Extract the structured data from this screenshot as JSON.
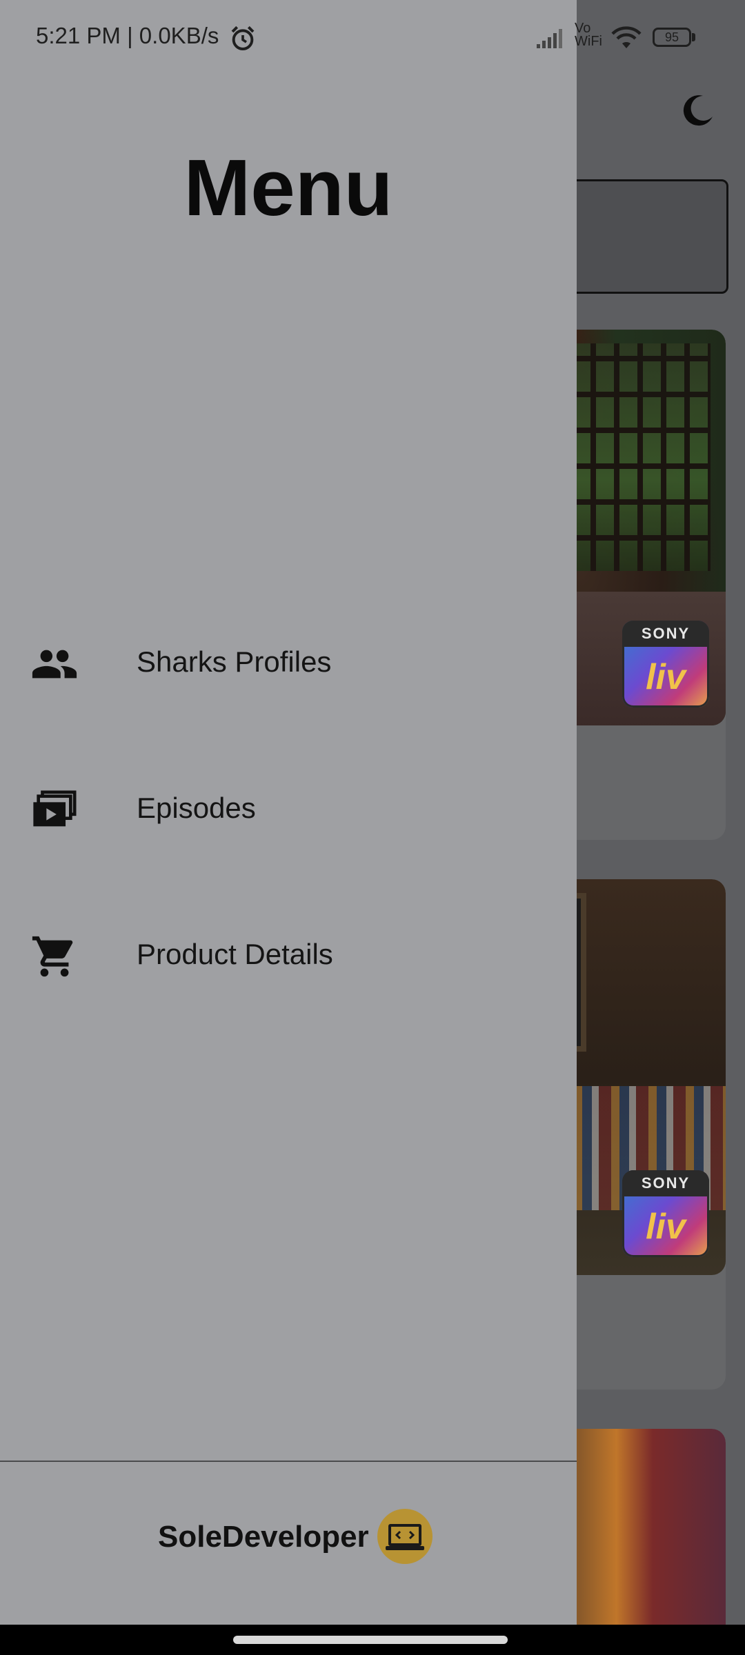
{
  "status_bar": {
    "time_speed": "5:21 PM | 0.0KB/s",
    "vowifi": "Vo\nWiFi",
    "battery": "95",
    "icons": [
      "alarm-icon",
      "signal-icon",
      "wifi-icon",
      "battery-icon"
    ]
  },
  "background": {
    "theme_toggle_icon": "moon-icon",
    "badges": [
      "SONY",
      "liv"
    ]
  },
  "drawer": {
    "title": "Menu",
    "items": [
      {
        "label": "Sharks Profiles",
        "icon": "people-icon"
      },
      {
        "label": "Episodes",
        "icon": "video-library-icon"
      },
      {
        "label": "Product Details",
        "icon": "cart-icon"
      }
    ],
    "footer": {
      "brand": "SoleDeveloper",
      "logo_text": "SoleDeveloper"
    }
  },
  "colors": {
    "drawer_bg": "#9fa0a3",
    "scrim_bg": "#5d5e61",
    "logo_gold": "#b89333"
  }
}
